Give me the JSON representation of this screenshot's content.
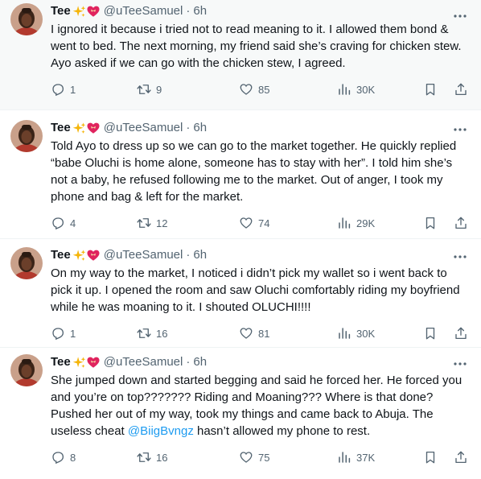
{
  "tweets": [
    {
      "name": "Tee",
      "handle": "@uTeeSamuel",
      "dot": "·",
      "time": "6h",
      "text": "I ignored it because i tried not to read meaning to it. I allowed them bond & went to bed. The next morning, my friend said she’s craving for chicken stew. Ayo asked if we can go with the chicken stew, I agreed.",
      "mention": "",
      "text_after": "",
      "replies": "1",
      "reposts": "9",
      "likes": "85",
      "views": "30K"
    },
    {
      "name": "Tee",
      "handle": "@uTeeSamuel",
      "dot": "·",
      "time": "6h",
      "text": "Told Ayo to dress up so we can go to the market together. He quickly replied “babe Oluchi is home alone, someone has to stay with her”. I told him she’s not a baby, he refused following me to the market. Out of anger, I took my phone and bag & left for the market.",
      "mention": "",
      "text_after": "",
      "replies": "4",
      "reposts": "12",
      "likes": "74",
      "views": "29K"
    },
    {
      "name": "Tee",
      "handle": "@uTeeSamuel",
      "dot": "·",
      "time": "6h",
      "text": "On my way to the market, I noticed i didn’t pick my wallet so i went back to pick it up. I opened the room and saw Oluchi comfortably riding my boyfriend while he was moaning to it. I shouted OLUCHI!!!!",
      "mention": "",
      "text_after": "",
      "replies": "1",
      "reposts": "16",
      "likes": "81",
      "views": "30K"
    },
    {
      "name": "Tee",
      "handle": "@uTeeSamuel",
      "dot": "·",
      "time": "6h",
      "text": "She jumped down and started begging and said he forced her. He forced you and you’re on top??????? Riding and Moaning??? Where is that done? Pushed her out of my way, took my things and came back to Abuja. The useless cheat ",
      "mention": "@BiigBvngz",
      "text_after": " hasn’t allowed my phone to rest.",
      "replies": "8",
      "reposts": "16",
      "likes": "75",
      "views": "37K"
    }
  ],
  "icons": {
    "badges": [
      "sparkles-icon",
      "heart-with-ribbon-icon"
    ],
    "more": "more-options-icon",
    "actions": [
      "reply-icon",
      "repost-icon",
      "like-icon",
      "views-icon",
      "bookmark-icon",
      "share-icon"
    ]
  },
  "colors": {
    "text": "#0f1419",
    "muted": "#536471",
    "link": "#1d9bf0",
    "heart": "#e0245e",
    "sparkle": "#f5b50a"
  }
}
